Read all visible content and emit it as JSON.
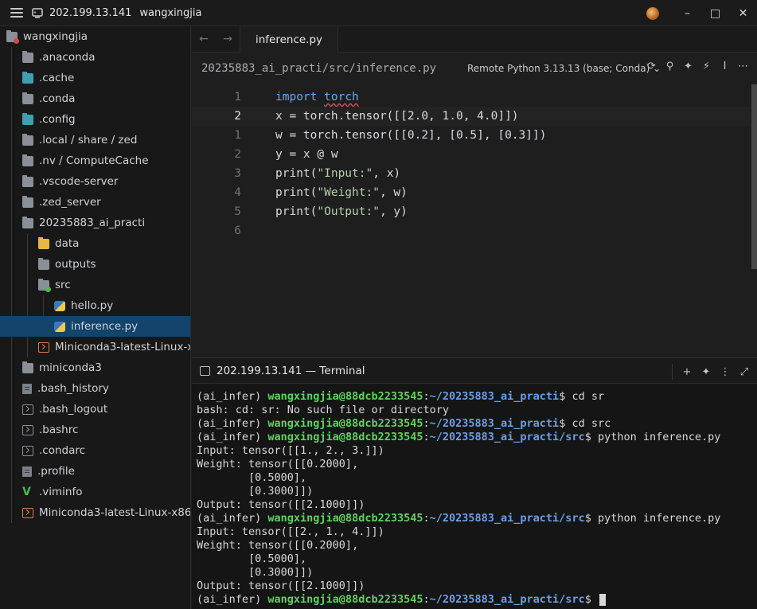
{
  "titlebar": {
    "host": "202.199.13.141",
    "user": "wangxingjia"
  },
  "sidebar": {
    "root": "wangxingjia",
    "items": [
      {
        "label": ".anaconda",
        "icon": "folder-icon"
      },
      {
        "label": ".cache",
        "icon": "folder-clock-icon"
      },
      {
        "label": ".conda",
        "icon": "folder-icon"
      },
      {
        "label": ".config",
        "icon": "folder-gear-icon"
      },
      {
        "label": ".local / share / zed",
        "icon": "folder-icon"
      },
      {
        "label": ".nv / ComputeCache",
        "icon": "folder-icon"
      },
      {
        "label": ".vscode-server",
        "icon": "folder-icon"
      },
      {
        "label": ".zed_server",
        "icon": "folder-icon"
      },
      {
        "label": "20235883_ai_practi",
        "icon": "folder-open-icon"
      },
      {
        "label": "data",
        "icon": "folder-data-icon"
      },
      {
        "label": "outputs",
        "icon": "folder-icon"
      },
      {
        "label": "src",
        "icon": "folder-src-icon"
      },
      {
        "label": "hello.py",
        "icon": "python-icon"
      },
      {
        "label": "inference.py",
        "icon": "python-icon"
      },
      {
        "label": "Miniconda3-latest-Linux-x8",
        "icon": "terminal-file-icon"
      },
      {
        "label": "miniconda3",
        "icon": "folder-icon"
      },
      {
        "label": ".bash_history",
        "icon": "file-icon"
      },
      {
        "label": ".bash_logout",
        "icon": "terminal-file-icon"
      },
      {
        "label": ".bashrc",
        "icon": "terminal-file-icon"
      },
      {
        "label": ".condarc",
        "icon": "terminal-file-icon"
      },
      {
        "label": ".profile",
        "icon": "file-icon"
      },
      {
        "label": ".viminfo",
        "icon": "vim-icon"
      },
      {
        "label": "Miniconda3-latest-Linux-x86_",
        "icon": "terminal-file-icon"
      }
    ]
  },
  "editor": {
    "tab": "inference.py",
    "breadcrumb": "20235883_ai_practi/src/inference.py",
    "kernel": "Remote Python 3.13.13 (base; Conda)",
    "line_numbers": [
      "1",
      "2",
      "1",
      "2",
      "3",
      "4",
      "5",
      "6"
    ],
    "lines": {
      "l1_kw": "import",
      "l1_mod": "torch",
      "l2": "x = torch.tensor([[2.0, 1.0, 4.0]])",
      "l3": "w = torch.tensor([[0.2], [0.5], [0.3]])",
      "l4": "y = x @ w",
      "l5_fn": "print(",
      "l5_str": "\"Input:\"",
      "l5_rest": ", x)",
      "l6_fn": "print(",
      "l6_str": "\"Weight:\"",
      "l6_rest": ", w)",
      "l7_fn": "print(",
      "l7_str": "\"Output:\"",
      "l7_rest": ", y)"
    }
  },
  "terminal": {
    "tab": "202.199.13.141 — Terminal",
    "env": "(ai_infer) ",
    "user_host": "wangxingjia@88dcb2233545",
    "path_home": "~/20235883_ai_practi",
    "path_src": "~/20235883_ai_practi/src",
    "cmd1": "$ cd sr",
    "out1": "bash: cd: sr: No such file or directory",
    "cmd2": "$ cd src",
    "cmd3": "$ python inference.py",
    "run1": [
      "Input: tensor([[1., 2., 3.]])",
      "Weight: tensor([[0.2000],",
      "        [0.5000],",
      "        [0.3000]])",
      "Output: tensor([[2.1000]])"
    ],
    "run2": [
      "Input: tensor([[2., 1., 4.]])",
      "Weight: tensor([[0.2000],",
      "        [0.5000],",
      "        [0.3000]])",
      "Output: tensor([[2.1000]])"
    ],
    "prompt_end": "$ "
  },
  "colors": {
    "accent_selection": "#12446c",
    "prompt_user": "#5fd35f",
    "prompt_path": "#6a9fe8",
    "keyword": "#6aa8e8"
  }
}
